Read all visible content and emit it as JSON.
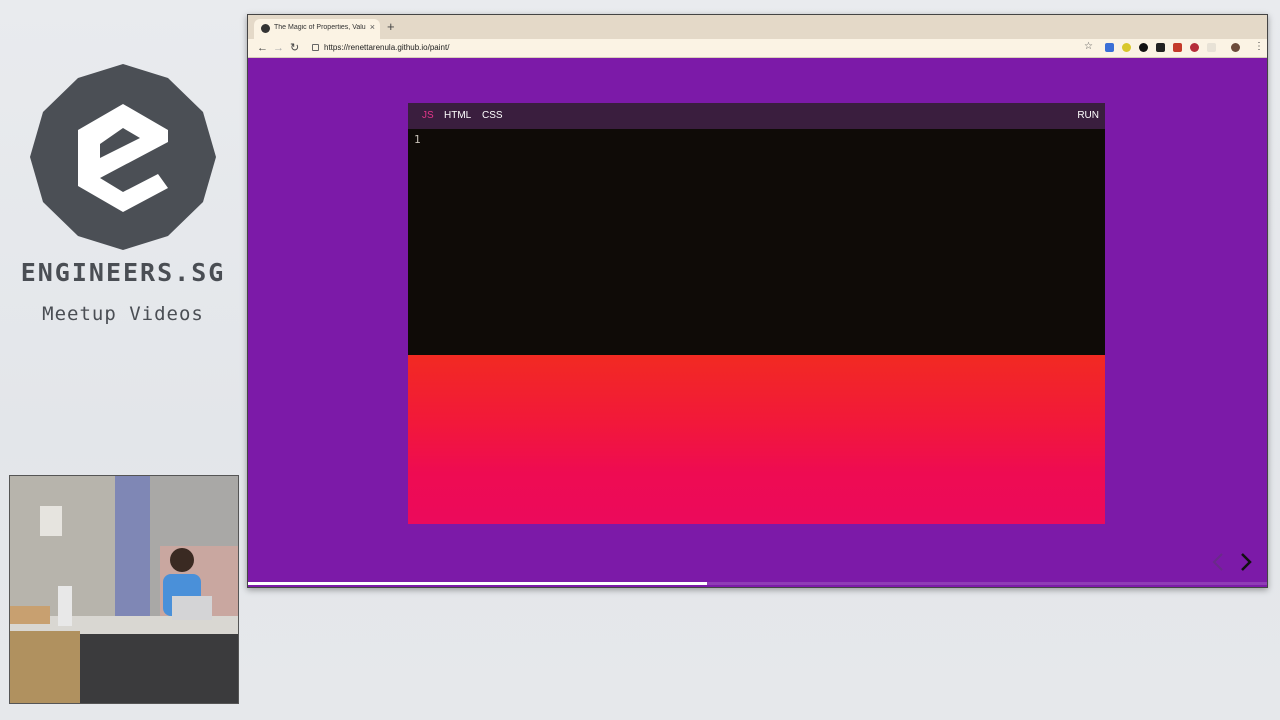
{
  "branding": {
    "name": "ENGINEERS.SG",
    "subtitle": "Meetup Videos"
  },
  "browser": {
    "tab_title": "The Magic of Properties, Valu",
    "tab_close": "×",
    "new_tab": "+",
    "url": "https://renettarenula.github.io/paint/",
    "nav": {
      "back": "←",
      "forward": "→",
      "reload": "↻"
    },
    "star": "☆",
    "menu": "⋮"
  },
  "editor": {
    "tabs": [
      {
        "label": "JS",
        "active": true
      },
      {
        "label": "HTML",
        "active": false
      },
      {
        "label": "CSS",
        "active": false
      }
    ],
    "run_label": "RUN",
    "line_number": "1",
    "colors": {
      "accent": "#e3368a",
      "toolbar": "#3a1e3e",
      "code_bg": "#0f0b07"
    }
  },
  "slide": {
    "background": "#7c1aa8",
    "prev": "‹",
    "next": "›",
    "progress": 0.45
  }
}
